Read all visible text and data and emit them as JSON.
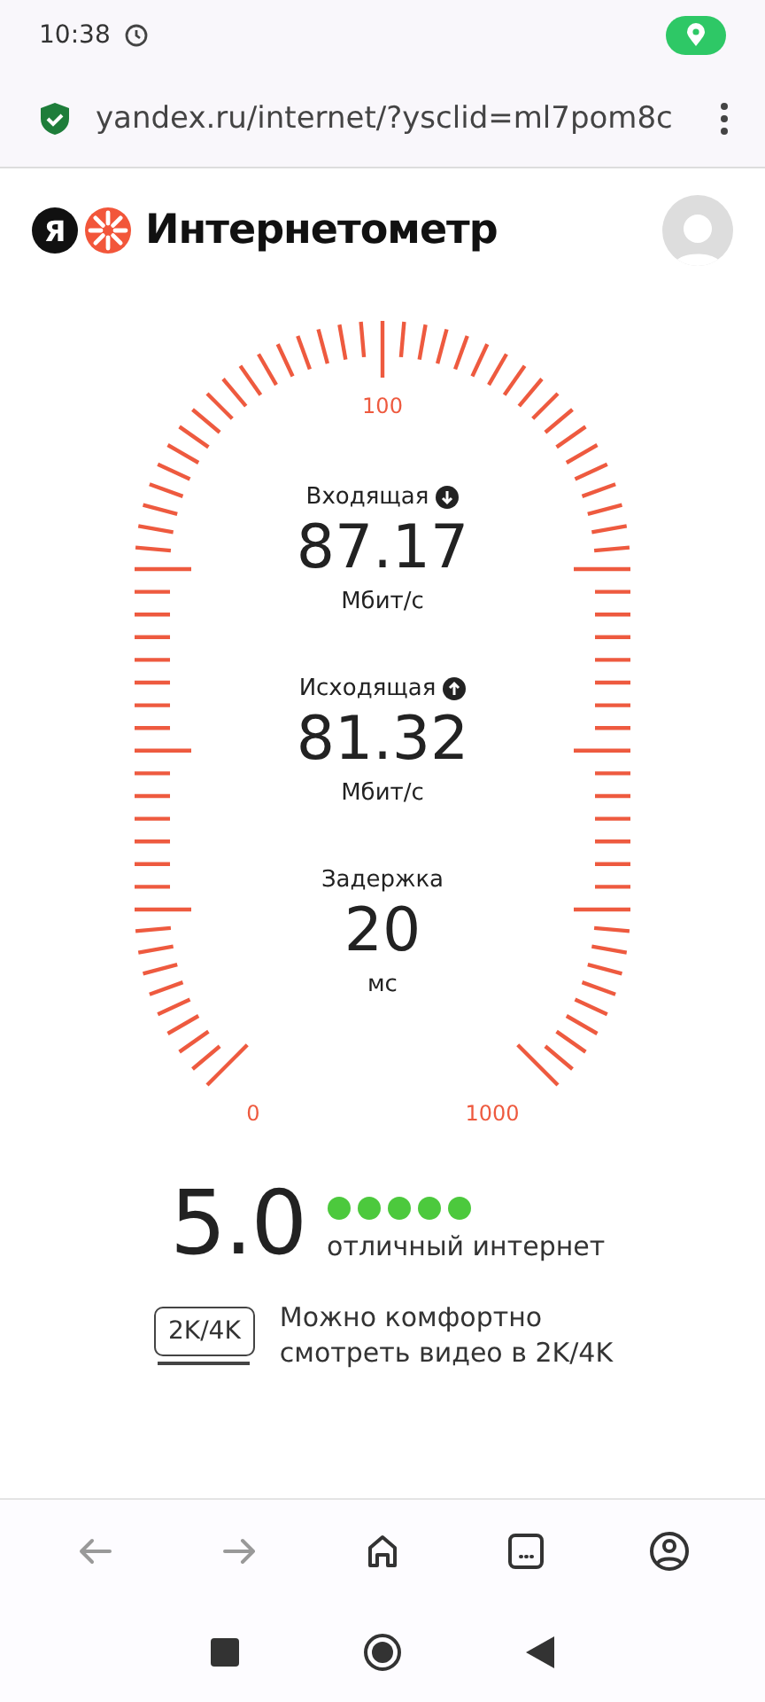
{
  "status_bar": {
    "time": "10:38"
  },
  "address_bar": {
    "url": "yandex.ru/internet/?ysclid=ml7pom8c"
  },
  "header": {
    "logo_letter": "Я",
    "title": "Интернетометр"
  },
  "gauge": {
    "scale_labels": [
      {
        "kind": "top",
        "text": "100"
      },
      {
        "kind": "left",
        "text": "0"
      },
      {
        "kind": "right",
        "text": "1000"
      }
    ]
  },
  "metrics": [
    {
      "kind": "download",
      "label": "Входящая",
      "value": "87.17",
      "unit": "Мбит/с"
    },
    {
      "kind": "upload",
      "label": "Исходящая",
      "value": "81.32",
      "unit": "Мбит/с"
    },
    {
      "kind": "latency",
      "label": "Задержка",
      "value": "20",
      "unit": "мс"
    }
  ],
  "rating": {
    "score": "5.0",
    "stars": 5,
    "verdict": "отличный интернет"
  },
  "recommendation": {
    "badge": "2K/4K",
    "text": "Можно комфортно смотреть видео в 2K/4K"
  },
  "browser_nav": [
    {
      "kind": "back",
      "disabled": true
    },
    {
      "kind": "forward",
      "disabled": true
    },
    {
      "kind": "home",
      "disabled": false
    },
    {
      "kind": "tabs",
      "disabled": false
    },
    {
      "kind": "profile",
      "disabled": false
    }
  ]
}
